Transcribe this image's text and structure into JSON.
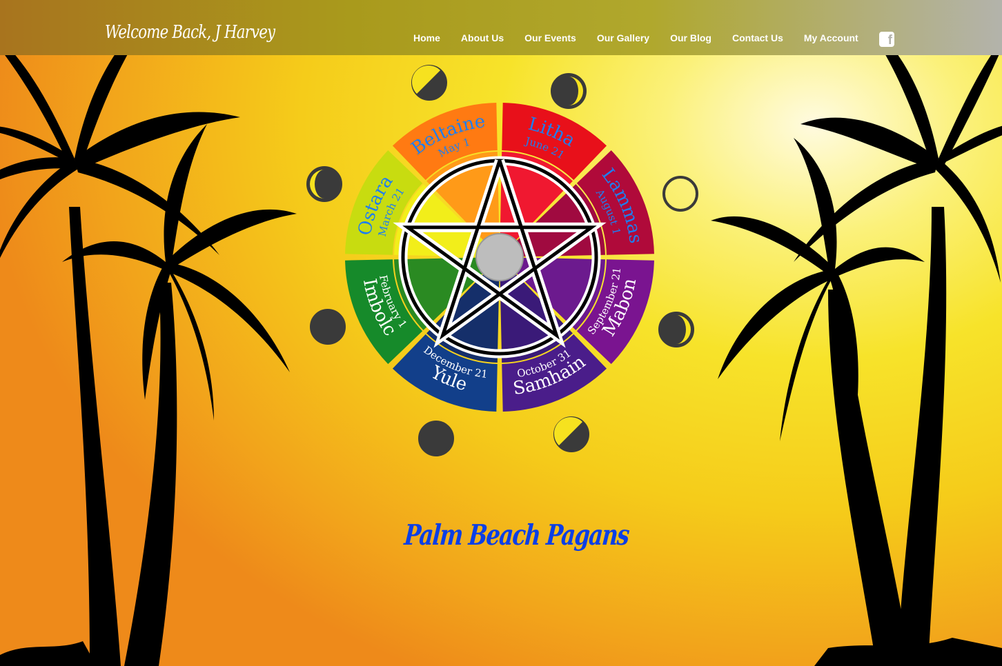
{
  "header": {
    "welcome_text": "Welcome Back, J Harvey",
    "nav": [
      "Home",
      "About Us",
      "Our Events",
      "Our Gallery",
      "Our Blog",
      "Contact Us",
      "My Account"
    ],
    "social_icon": "facebook-icon"
  },
  "wheel": {
    "sabbats": [
      {
        "name": "Ostara",
        "date": "March 21"
      },
      {
        "name": "Beltaine",
        "date": "May 1"
      },
      {
        "name": "Litha",
        "date": "June 21"
      },
      {
        "name": "Lammas",
        "date": "August 1"
      },
      {
        "name": "Mabon",
        "date": "September 21"
      },
      {
        "name": "Samhain",
        "date": "October 31"
      },
      {
        "name": "Yule",
        "date": "December 21"
      },
      {
        "name": "Imbolc",
        "date": "February 1"
      }
    ]
  },
  "site_title": "Palm Beach Pagans",
  "colors": {
    "title": "#0b3fe6",
    "label_light": "#1e7ef0",
    "label_dark": "#ffffff"
  }
}
